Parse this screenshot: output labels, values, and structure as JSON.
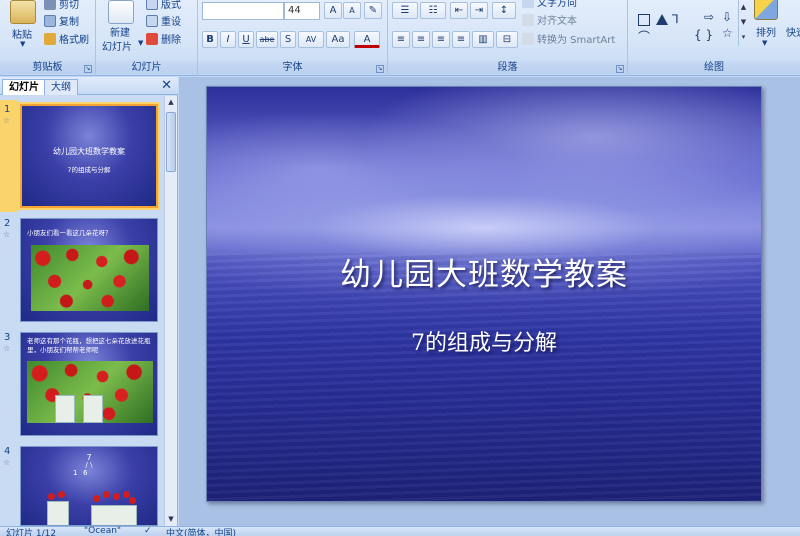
{
  "ribbon": {
    "clipboard": {
      "label": "剪贴板",
      "paste": "粘贴",
      "cut": "剪切",
      "copy": "复制",
      "format_painter": "格式刷"
    },
    "slides": {
      "label": "幻灯片",
      "new_slide": "新建",
      "new_slide_line2": "幻灯片",
      "layout": "版式",
      "reset": "重设",
      "delete": "删除"
    },
    "font": {
      "label": "字体",
      "font_name": "",
      "font_size": "44",
      "grow": "A",
      "shrink": "A",
      "bold": "B",
      "italic": "I",
      "underline": "U",
      "strike": "abe",
      "shadow": "S",
      "spacing": "AV",
      "case": "Aa",
      "color": "A"
    },
    "paragraph": {
      "label": "段落",
      "text_direction": "文字方向",
      "align_text": "对齐文本",
      "smartart": "转换为 SmartArt"
    },
    "drawing": {
      "label": "绘图",
      "arrange": "排列",
      "quick_styles": "快速"
    }
  },
  "pane": {
    "tabs": [
      "幻灯片",
      "大纲"
    ],
    "close": "✕",
    "slides": [
      {
        "num": "1",
        "title": "幼儿园大班数学教案",
        "subtitle": "7的组成与分解"
      },
      {
        "num": "2",
        "text": "小朋友们看一看这几朵花呀？"
      },
      {
        "num": "3",
        "text": "老师这有那个花瓶，想把这七朵花放进花瓶里，小朋友们帮帮老师呢"
      },
      {
        "num": "4",
        "top": "7",
        "split_left": "1",
        "split_right": "6"
      }
    ]
  },
  "slide": {
    "title": "幼儿园大班数学教案",
    "subtitle": "7的组成与分解"
  },
  "status": {
    "slide_index": "幻灯片 1/12",
    "theme": "\"Ocean\"",
    "language": "中文(简体，中国)"
  },
  "colors": {
    "accent": "#f3a432",
    "ribbon": "#d5e4f7",
    "slide_bg": "#3b3fa8"
  }
}
